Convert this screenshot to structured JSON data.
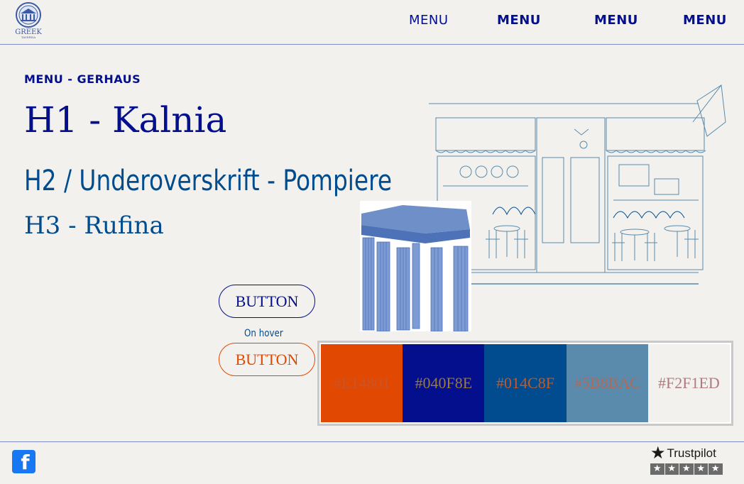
{
  "header": {
    "logo": {
      "brand": "GREEK",
      "sub": "TAVERNA",
      "icon": "temple-logo-icon"
    },
    "nav": [
      {
        "label": "MENU"
      },
      {
        "label": "MENU"
      },
      {
        "label": "MENU"
      },
      {
        "label": "MENU"
      }
    ]
  },
  "typography": {
    "eyebrow": "MENU - GERHAUS",
    "h1": "H1 - Kalnia",
    "h2": "H2 / Underoverskrift - Pompiere",
    "h3": "H3 - Rufina"
  },
  "buttons": {
    "primary_label": "BUTTON",
    "hover_caption": "On hover",
    "hover_label": "BUTTON"
  },
  "palette": [
    {
      "label": "#E14801",
      "color": "#E14801",
      "text_color": "#c9552a"
    },
    {
      "label": "#040F8E",
      "color": "#040F8E",
      "text_color": "#9a7a3a"
    },
    {
      "label": "#014C8F",
      "color": "#014C8F",
      "text_color": "#c05a2a"
    },
    {
      "label": "#5B8BAC",
      "color": "#5B8BAC",
      "text_color": "#b06a55"
    },
    {
      "label": "#F2F1ED",
      "color": "#F2F1ED",
      "text_color": "#b07a80"
    }
  ],
  "images": {
    "cafe": "cafe-storefront-illustration",
    "columns": "greek-columns-illustration"
  },
  "footer": {
    "facebook_icon": "facebook-icon",
    "trustpilot_label": "Trustpilot",
    "trustpilot_stars": [
      "★",
      "★",
      "★",
      "★",
      "★"
    ]
  }
}
